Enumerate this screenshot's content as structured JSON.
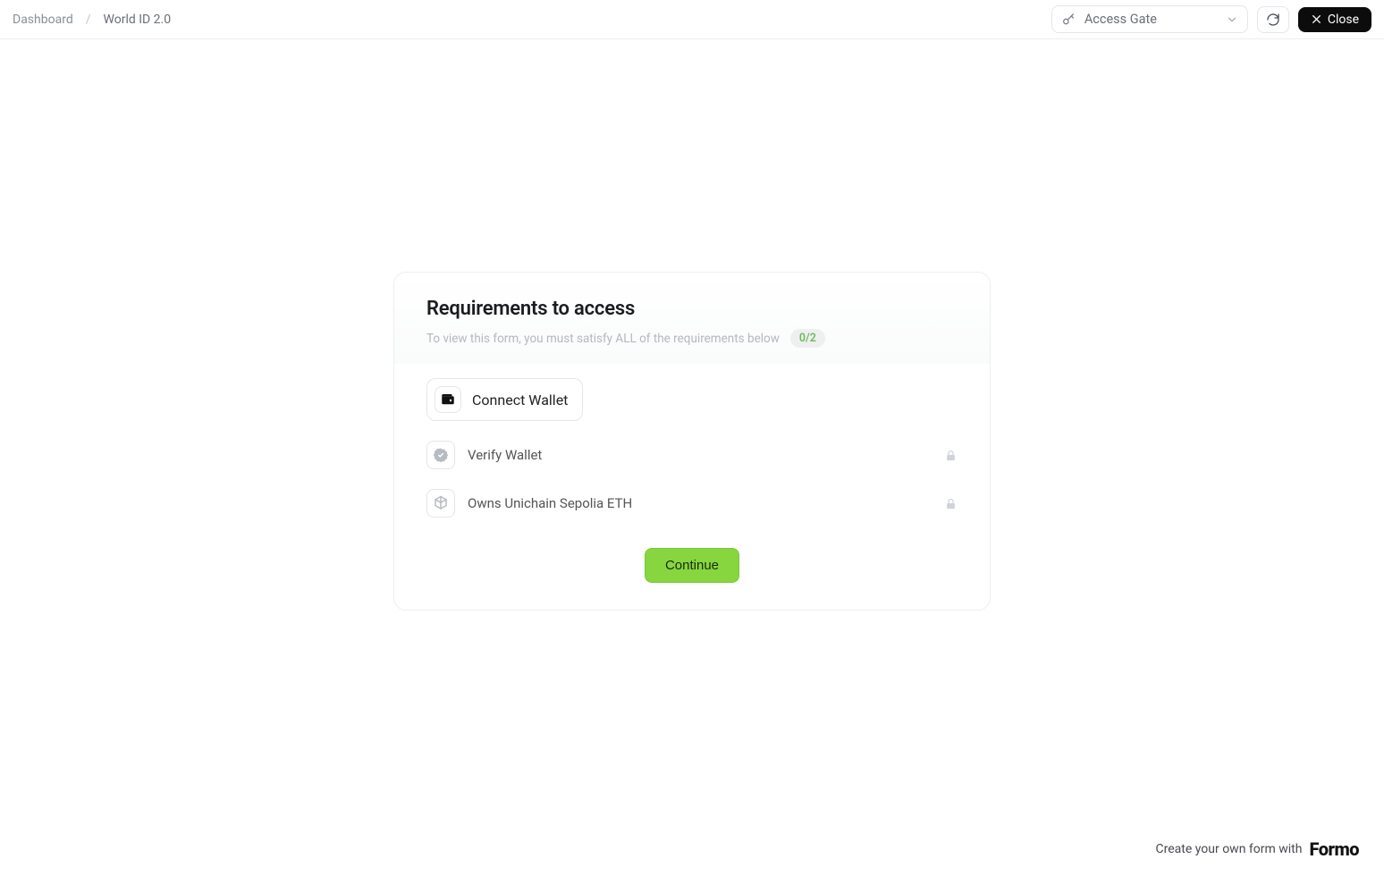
{
  "breadcrumb": {
    "root": "Dashboard",
    "current": "World ID 2.0"
  },
  "header": {
    "selector_label": "Access Gate",
    "close_label": "Close"
  },
  "card": {
    "title": "Requirements to access",
    "subtitle": "To view this form, you must satisfy ALL of the requirements below",
    "progress": "0/2",
    "connect_label": "Connect Wallet",
    "requirements": {
      "0": {
        "label": "Verify Wallet"
      },
      "1": {
        "label": "Owns Unichain Sepolia ETH"
      }
    },
    "continue_label": "Continue"
  },
  "footer": {
    "text": "Create your own form with",
    "brand": "Formo"
  }
}
